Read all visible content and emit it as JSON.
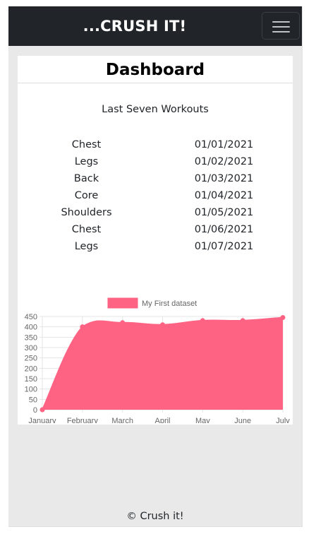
{
  "navbar": {
    "brand": "...CRUSH IT!",
    "menu_icon": "hamburger-menu-icon"
  },
  "card": {
    "title": "Dashboard",
    "subtitle": "Last Seven Workouts"
  },
  "workouts": [
    {
      "name": "Chest",
      "date": "01/01/2021"
    },
    {
      "name": "Legs",
      "date": "01/02/2021"
    },
    {
      "name": "Back",
      "date": "01/03/2021"
    },
    {
      "name": "Core",
      "date": "01/04/2021"
    },
    {
      "name": "Shoulders",
      "date": "01/05/2021"
    },
    {
      "name": "Chest",
      "date": "01/06/2021"
    },
    {
      "name": "Legs",
      "date": "01/07/2021"
    }
  ],
  "chart_data": {
    "type": "area",
    "categories": [
      "January",
      "February",
      "March",
      "April",
      "May",
      "June",
      "July"
    ],
    "series": [
      {
        "name": "My First dataset",
        "values": [
          0,
          400,
          420,
          410,
          430,
          430,
          445
        ],
        "color": "#ff6384"
      }
    ],
    "yticks": [
      0,
      50,
      100,
      150,
      200,
      250,
      300,
      350,
      400,
      450
    ],
    "ylim": [
      0,
      450
    ],
    "grid": true,
    "legend": "top-center",
    "title": "",
    "xlabel": "",
    "ylabel": ""
  },
  "footer": {
    "text": "© Crush it!"
  },
  "colors": {
    "navbar": "#212529",
    "background": "#e9e9e9",
    "series": "#ff6384"
  }
}
